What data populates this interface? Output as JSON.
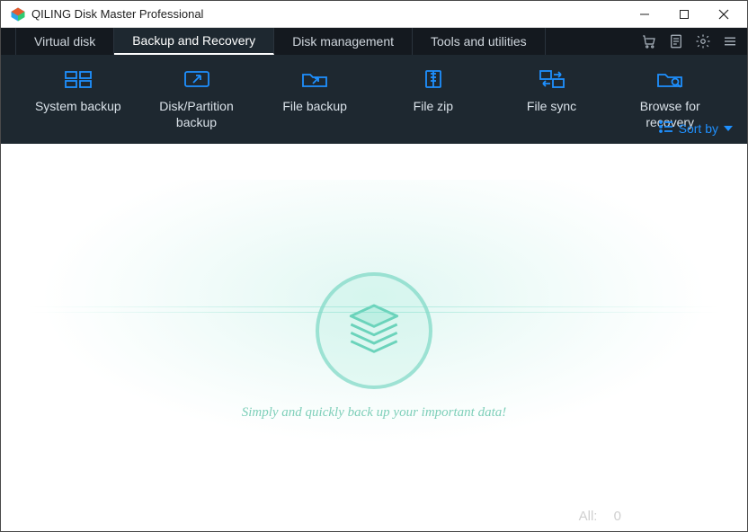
{
  "window": {
    "title": "QILING Disk Master Professional"
  },
  "tabs": [
    {
      "label": "Virtual disk"
    },
    {
      "label": "Backup and Recovery"
    },
    {
      "label": "Disk management"
    },
    {
      "label": "Tools and utilities"
    }
  ],
  "toolbar": [
    {
      "label": "System backup"
    },
    {
      "label": "Disk/Partition\nbackup"
    },
    {
      "label": "File backup"
    },
    {
      "label": "File zip"
    },
    {
      "label": "File sync"
    },
    {
      "label": "Browse for\nrecovery"
    }
  ],
  "sort": {
    "label": "Sort by"
  },
  "hero": {
    "tagline": "Simply and quickly back up your important data!"
  },
  "footer": {
    "all_label": "All:",
    "count": "0"
  }
}
